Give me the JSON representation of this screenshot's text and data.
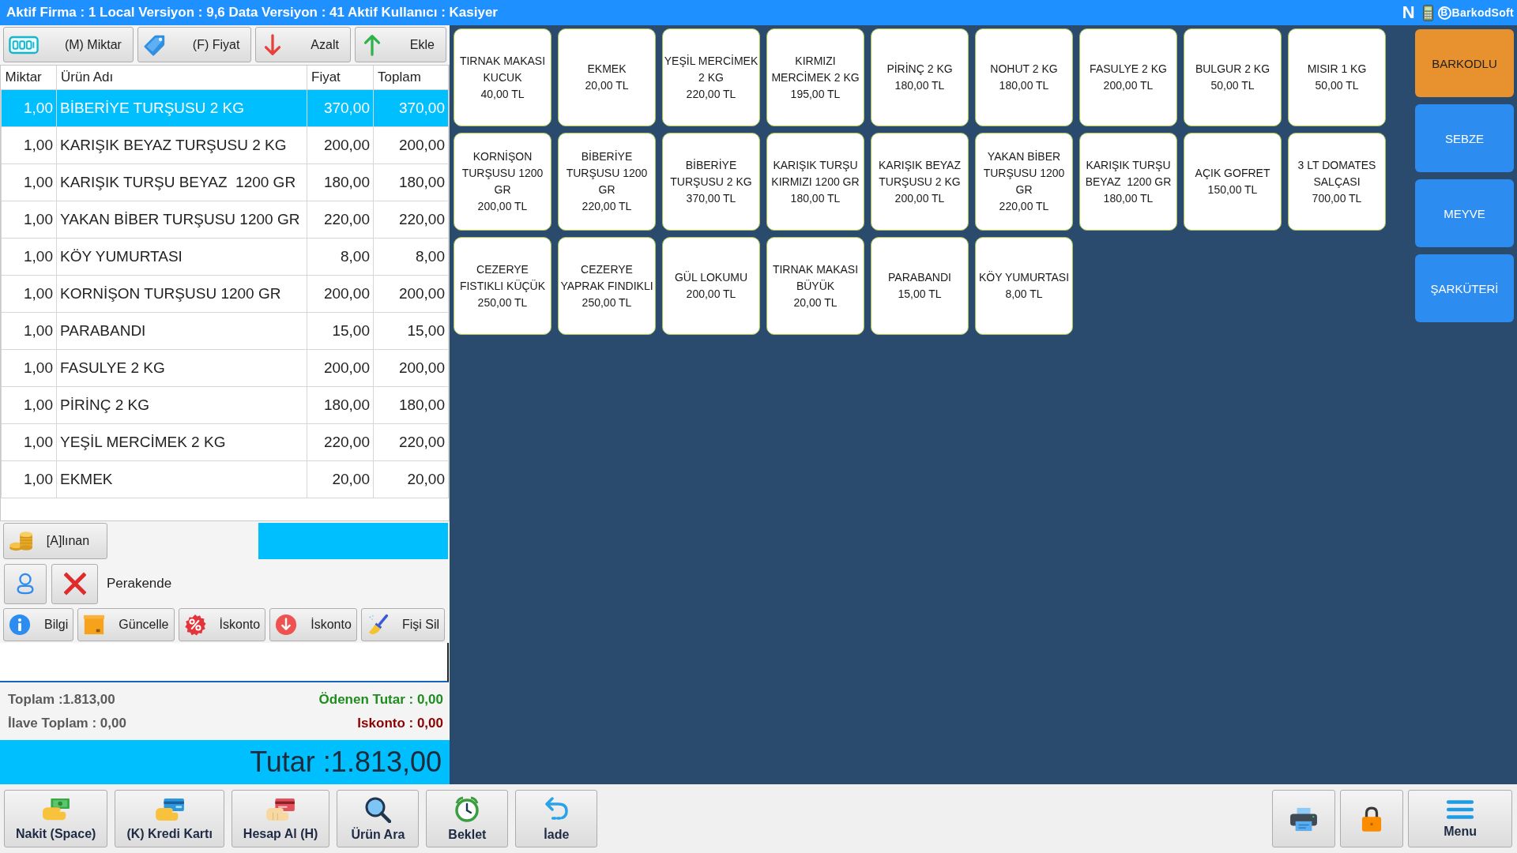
{
  "title_bar": {
    "text": "Aktif Firma : 1 Local Versiyon : 9,6 Data Versiyon : 41 Aktif Kullanıcı : Kasiyer",
    "indicator": "N",
    "brand_mark": "B",
    "brand_name": "BarkodSoft"
  },
  "toolbar": [
    {
      "kind": "quantity",
      "label": "(M) Miktar"
    },
    {
      "kind": "price",
      "label": "(F) Fiyat"
    },
    {
      "kind": "decrease",
      "label": "Azalt"
    },
    {
      "kind": "increase",
      "label": "Ekle"
    }
  ],
  "cart": {
    "columns": [
      "Miktar",
      "Ürün Adı",
      "Fiyat",
      "Toplam"
    ],
    "rows": [
      {
        "cells": [
          "1,00",
          "BİBERİYE TURŞUSU 2 KG",
          "370,00",
          "370,00"
        ],
        "selected": true
      },
      {
        "cells": [
          "1,00",
          "KARIŞIK BEYAZ TURŞUSU 2 KG",
          "200,00",
          "200,00"
        ],
        "selected": false
      },
      {
        "cells": [
          "1,00",
          "KARIŞIK TURŞU BEYAZ  1200 GR",
          "180,00",
          "180,00"
        ],
        "selected": false
      },
      {
        "cells": [
          "1,00",
          "YAKAN BİBER TURŞUSU 1200 GR",
          "220,00",
          "220,00"
        ],
        "selected": false
      },
      {
        "cells": [
          "1,00",
          "KÖY YUMURTASI",
          "8,00",
          "8,00"
        ],
        "selected": false
      },
      {
        "cells": [
          "1,00",
          "KORNİŞON TURŞUSU 1200 GR",
          "200,00",
          "200,00"
        ],
        "selected": false
      },
      {
        "cells": [
          "1,00",
          "PARABANDI",
          "15,00",
          "15,00"
        ],
        "selected": false
      },
      {
        "cells": [
          "1,00",
          "FASULYE 2 KG",
          "200,00",
          "200,00"
        ],
        "selected": false
      },
      {
        "cells": [
          "1,00",
          "PİRİNÇ 2 KG",
          "180,00",
          "180,00"
        ],
        "selected": false
      },
      {
        "cells": [
          "1,00",
          "YEŞİL MERCİMEK 2 KG",
          "220,00",
          "220,00"
        ],
        "selected": false
      },
      {
        "cells": [
          "1,00",
          "EKMEK",
          "20,00",
          "20,00"
        ],
        "selected": false
      }
    ]
  },
  "payment": {
    "received_button": "[A]lınan",
    "customer": "Perakende"
  },
  "actions": [
    {
      "kind": "info",
      "label": "Bilgi"
    },
    {
      "kind": "update",
      "label": "Güncelle"
    },
    {
      "kind": "percent",
      "label": "İskonto"
    },
    {
      "kind": "discount",
      "label": "İskonto"
    },
    {
      "kind": "clear",
      "label": "Fişi Sil"
    }
  ],
  "totals": [
    {
      "text": "Toplam :1.813,00",
      "color": "#5a5a5a"
    },
    {
      "text": "Ödenen Tutar : 0,00",
      "color": "#1e8c1e"
    },
    {
      "text": "İlave Toplam : 0,00",
      "color": "#5a5a5a"
    },
    {
      "text": "Iskonto : 0,00",
      "color": "#8b0000"
    }
  ],
  "grand_total": "Tutar :1.813,00",
  "products": [
    {
      "name": "TIRNAK MAKASI KUCUK",
      "price": "40,00 TL"
    },
    {
      "name": "EKMEK",
      "price": "20,00 TL"
    },
    {
      "name": "YEŞİL MERCİMEK 2 KG",
      "price": "220,00 TL"
    },
    {
      "name": "KIRMIZI MERCİMEK 2 KG",
      "price": "195,00 TL"
    },
    {
      "name": "PİRİNÇ 2 KG",
      "price": "180,00 TL"
    },
    {
      "name": "NOHUT 2 KG",
      "price": "180,00 TL"
    },
    {
      "name": "FASULYE 2 KG",
      "price": "200,00 TL"
    },
    {
      "name": "BULGUR 2 KG",
      "price": "50,00 TL"
    },
    {
      "name": "MISIR 1 KG",
      "price": "50,00 TL"
    },
    {
      "name": "KORNİŞON TURŞUSU 1200 GR",
      "price": "200,00 TL"
    },
    {
      "name": "BİBERİYE TURŞUSU 1200 GR",
      "price": "220,00 TL"
    },
    {
      "name": "BİBERİYE TURŞUSU 2 KG",
      "price": "370,00 TL"
    },
    {
      "name": "KARIŞIK TURŞU KIRMIZI 1200 GR",
      "price": "180,00 TL"
    },
    {
      "name": "KARIŞIK BEYAZ TURŞUSU 2 KG",
      "price": "200,00 TL"
    },
    {
      "name": "YAKAN BİBER TURŞUSU 1200 GR",
      "price": "220,00 TL"
    },
    {
      "name": "KARIŞIK TURŞU BEYAZ  1200 GR",
      "price": "180,00 TL"
    },
    {
      "name": "AÇIK GOFRET",
      "price": "150,00 TL"
    },
    {
      "name": "3 LT DOMATES SALÇASI",
      "price": "700,00 TL"
    },
    {
      "name": "CEZERYE FISTIKLI KÜÇÜK",
      "price": "250,00 TL"
    },
    {
      "name": "CEZERYE YAPRAK FINDIKLI",
      "price": "250,00 TL"
    },
    {
      "name": "GÜL LOKUMU",
      "price": "200,00 TL"
    },
    {
      "name": "TIRNAK MAKASI BÜYÜK",
      "price": "20,00 TL"
    },
    {
      "name": "PARABANDI",
      "price": "15,00 TL"
    },
    {
      "name": "KÖY YUMURTASI",
      "price": "8,00 TL"
    }
  ],
  "categories": [
    {
      "label": "BARKODLU",
      "selected": true
    },
    {
      "label": "SEBZE",
      "selected": false
    },
    {
      "label": "MEYVE",
      "selected": false
    },
    {
      "label": "ŞARKÜTERİ",
      "selected": false
    }
  ],
  "bottom_bar": {
    "left": [
      {
        "kind": "cash",
        "label": "Nakit (Space)"
      },
      {
        "kind": "card",
        "label": "(K) Kredi Kartı"
      },
      {
        "kind": "account",
        "label": "Hesap Al (H)"
      },
      {
        "kind": "search",
        "label": "Ürün Ara"
      },
      {
        "kind": "hold",
        "label": "Beklet"
      },
      {
        "kind": "refund",
        "label": "İade"
      }
    ],
    "right": [
      {
        "kind": "print"
      },
      {
        "kind": "lock"
      },
      {
        "kind": "menu",
        "label": "Menu"
      }
    ]
  }
}
